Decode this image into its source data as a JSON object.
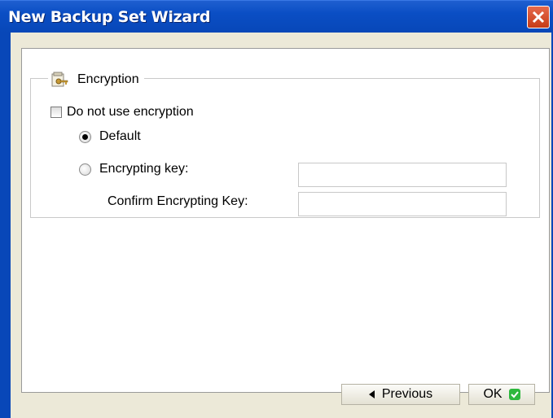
{
  "window": {
    "title": "New Backup Set Wizard"
  },
  "encryption": {
    "group_title": "Encryption",
    "do_not_use_label": "Do not use encryption",
    "do_not_use_checked": false,
    "default_label": "Default",
    "default_selected": true,
    "encrypting_key_label": "Encrypting key:",
    "encrypting_key_value": "",
    "confirm_key_label": "Confirm Encrypting Key:",
    "confirm_key_value": ""
  },
  "footer": {
    "previous_label": "Previous",
    "ok_label": "OK"
  },
  "icons": {
    "group": "key-folder-icon",
    "previous": "triangle-left-icon",
    "ok": "green-check-icon",
    "close": "close-icon"
  },
  "colors": {
    "titlebar": "#0a4ec4",
    "close": "#c63b17",
    "ok_check": "#2db83d"
  }
}
